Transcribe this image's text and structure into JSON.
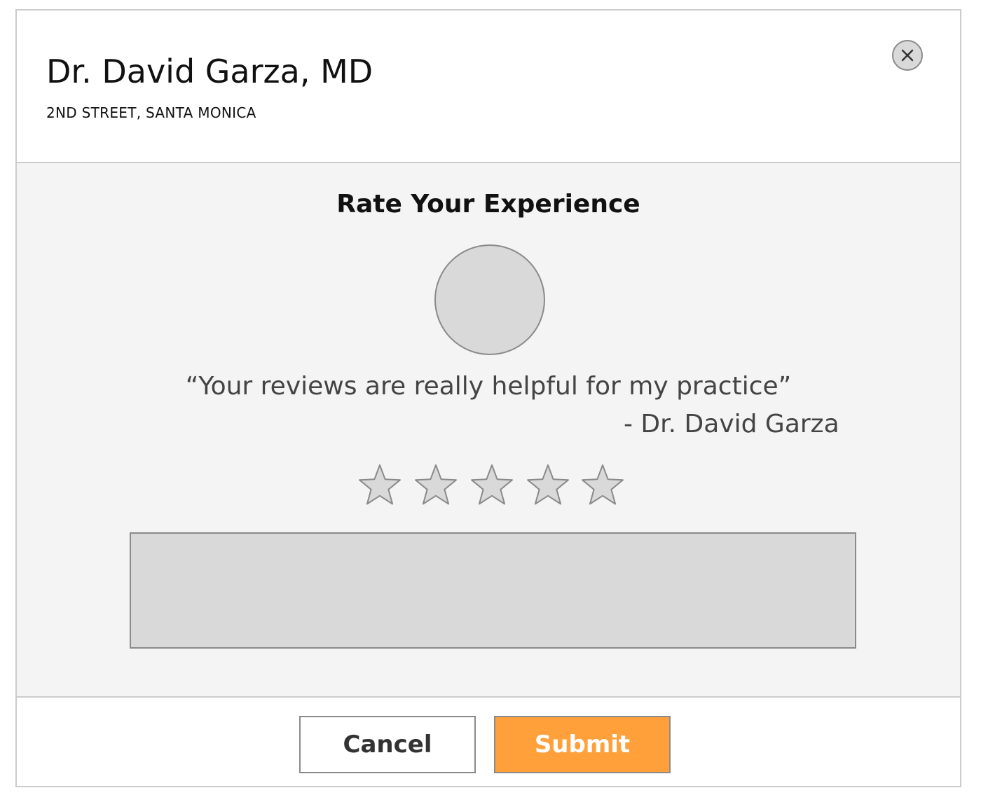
{
  "header": {
    "doctor_name": "Dr. David Garza, MD",
    "address": "2ND STREET, SANTA MONICA",
    "close_icon": "close-icon"
  },
  "rating": {
    "title": "Rate Your Experience",
    "avatar_icon": "avatar-placeholder",
    "quote": "“Your reviews are really helpful for my practice”",
    "attribution": "- Dr. David Garza",
    "stars_total": 5,
    "stars_selected": 0,
    "comment_value": "",
    "comment_placeholder": ""
  },
  "footer": {
    "cancel_label": "Cancel",
    "submit_label": "Submit"
  },
  "colors": {
    "accent": "#ffa03b",
    "panel_background": "#f4f4f4",
    "placeholder_fill": "#d9d9d9",
    "border": "#8a8a8a"
  }
}
